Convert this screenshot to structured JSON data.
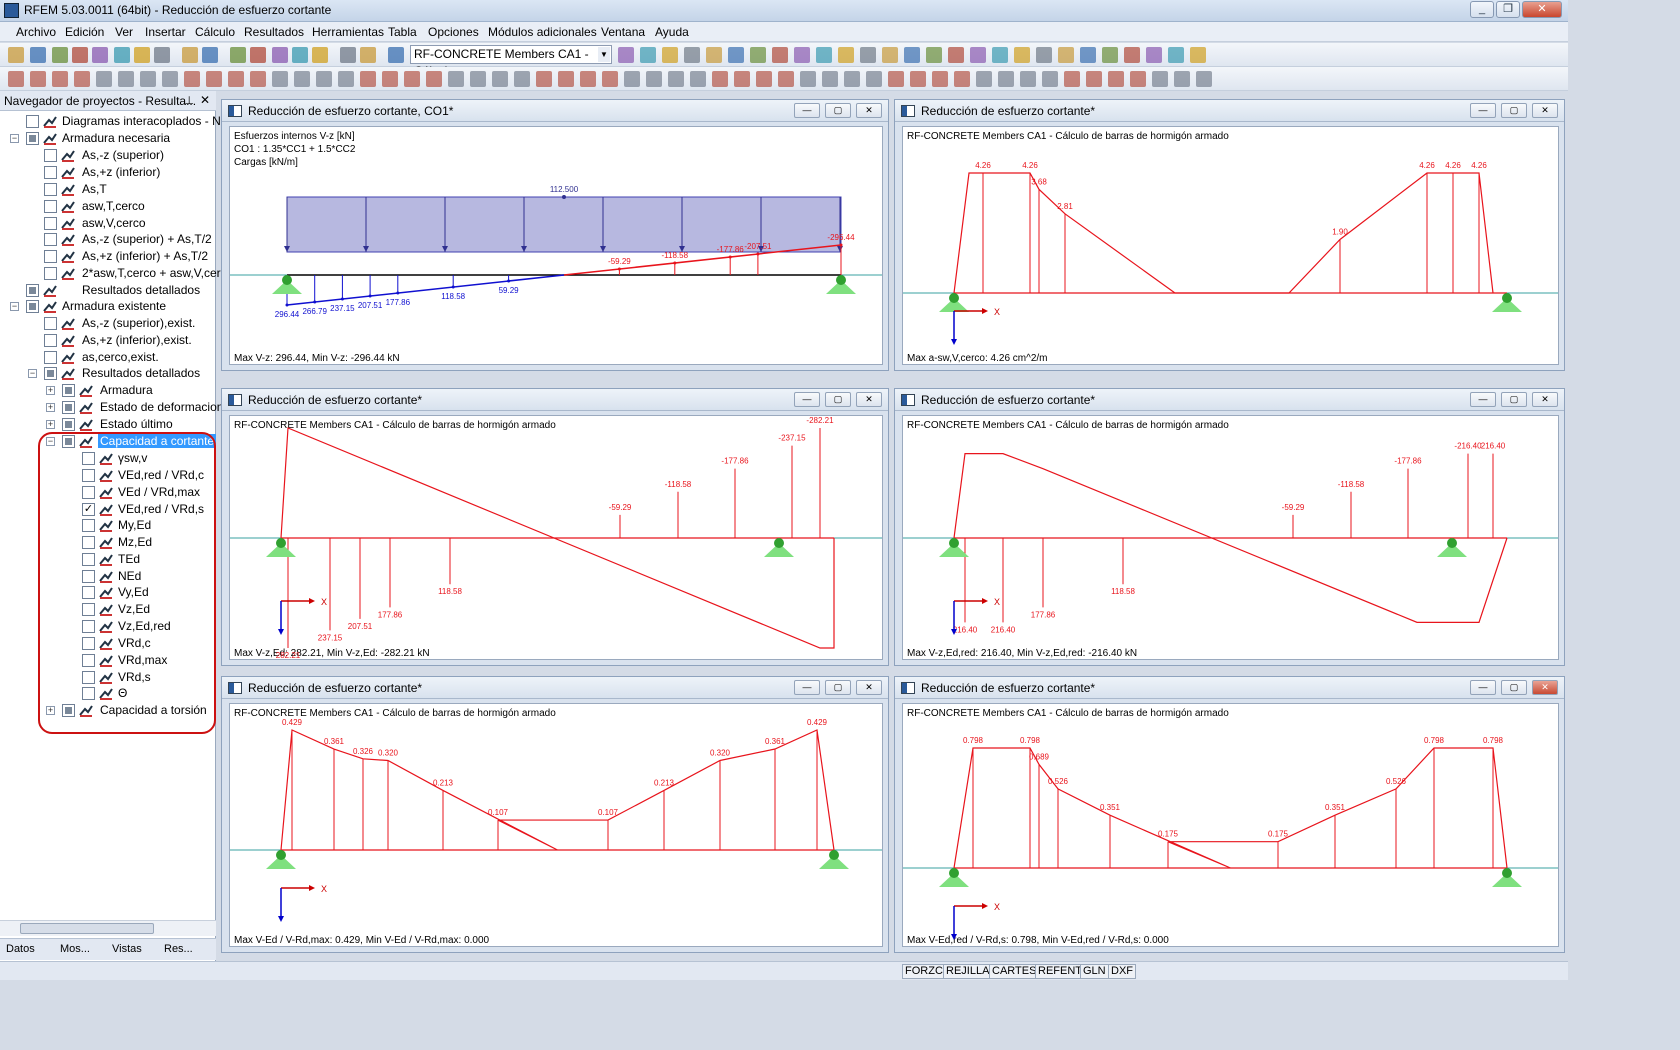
{
  "window": {
    "title": "RFEM 5.03.0011 (64bit) - Reducción de esfuerzo cortante"
  },
  "menu": [
    "Archivo",
    "Edición",
    "Ver",
    "Insertar",
    "Cálculo",
    "Resultados",
    "Herramientas",
    "Tabla",
    "Opciones",
    "Módulos adicionales",
    "Ventana",
    "Ayuda"
  ],
  "toolbar": {
    "module_combo": "RF-CONCRETE Members CA1 - Cálculo"
  },
  "navigator": {
    "title": "Navegador de proyectos - Resulta...",
    "tabs": [
      "Datos",
      "Mos...",
      "Vistas",
      "Res..."
    ],
    "items": [
      {
        "label": "Diagramas interacoplados - Nc"
      },
      {
        "label": "Armadura necesaria"
      },
      {
        "label": "As,-z (superior)"
      },
      {
        "label": "As,+z (inferior)"
      },
      {
        "label": "As,T"
      },
      {
        "label": "asw,T,cerco"
      },
      {
        "label": "asw,V,cerco"
      },
      {
        "label": "As,-z (superior) + As,T/2"
      },
      {
        "label": "As,+z (inferior) + As,T/2"
      },
      {
        "label": "2*asw,T,cerco + asw,V,cerco"
      },
      {
        "label": "Resultados detallados"
      },
      {
        "label": "Armadura existente"
      },
      {
        "label": "As,-z (superior),exist."
      },
      {
        "label": "As,+z (inferior),exist."
      },
      {
        "label": "as,cerco,exist."
      },
      {
        "label": "Resultados detallados"
      },
      {
        "label": "Armadura"
      },
      {
        "label": "Estado de deformacion"
      },
      {
        "label": "Estado último"
      },
      {
        "label": "Capacidad a cortante"
      },
      {
        "label": "γsw,v"
      },
      {
        "label": "VEd,red / VRd,c"
      },
      {
        "label": "VEd / VRd,max"
      },
      {
        "label": "VEd,red / VRd,s"
      },
      {
        "label": "My,Ed"
      },
      {
        "label": "Mz,Ed"
      },
      {
        "label": "TEd"
      },
      {
        "label": "NEd"
      },
      {
        "label": "Vy,Ed"
      },
      {
        "label": "Vz,Ed"
      },
      {
        "label": "Vz,Ed,red"
      },
      {
        "label": "VRd,c"
      },
      {
        "label": "VRd,max"
      },
      {
        "label": "VRd,s"
      },
      {
        "label": "Θ"
      },
      {
        "label": "Capacidad a torsión"
      }
    ]
  },
  "panes": [
    {
      "title": "Reducción de esfuerzo cortante, CO1*",
      "lines": [
        "Esfuerzos internos V-z [kN]",
        "CO1 : 1.35*CC1 + 1.5*CC2",
        "Cargas [kN/m]"
      ],
      "footer": "Max V-z: 296.44, Min V-z: -296.44 kN"
    },
    {
      "title": "Reducción de esfuerzo cortante*",
      "lines": [
        "RF-CONCRETE Members CA1 - Cálculo de barras de hormigón armado"
      ],
      "footer": "Max a-sw,V,cerco: 4.26 cm^2/m"
    },
    {
      "title": "Reducción de esfuerzo cortante*",
      "lines": [
        "RF-CONCRETE Members CA1 - Cálculo de barras de hormigón armado"
      ],
      "footer": "Max V-z,Ed: 282.21, Min V-z,Ed: -282.21 kN"
    },
    {
      "title": "Reducción de esfuerzo cortante*",
      "lines": [
        "RF-CONCRETE Members CA1 - Cálculo de barras de hormigón armado"
      ],
      "footer": "Max V-z,Ed,red: 216.40, Min V-z,Ed,red: -216.40 kN"
    },
    {
      "title": "Reducción de esfuerzo cortante*",
      "lines": [
        "RF-CONCRETE Members CA1 - Cálculo de barras de hormigón armado"
      ],
      "footer": "Max V-Ed / V-Rd,max: 0.429, Min V-Ed / V-Rd,max: 0.000"
    },
    {
      "title": "Reducción de esfuerzo cortante*",
      "lines": [
        "RF-CONCRETE Members CA1 - Cálculo de barras de hormigón armado"
      ],
      "footer": "Max V-Ed,red / V-Rd,s: 0.798, Min V-Ed,red / V-Rd,s: 0.000"
    }
  ],
  "statusbar": [
    "FORZC",
    "REJILLA",
    "CARTES",
    "REFENT",
    "GLN",
    "DXF"
  ],
  "chart_data": [
    {
      "type": "line",
      "title": "Esfuerzos internos V-z [kN]",
      "ylabel": "V-z [kN]",
      "load_label": "112.500",
      "series": [
        {
          "values": [
            -296.44,
            -266.79,
            -237.15,
            -207.51,
            -177.86,
            -118.58,
            -59.29,
            59.29,
            118.58,
            177.86,
            207.51,
            296.44
          ]
        }
      ],
      "labels": [
        "296.44",
        "266.79",
        "237.15",
        "207.51",
        "177.86",
        "118.58",
        "59.29",
        "-59.29",
        "-118.58",
        "-177.86",
        "-207.51",
        "-296.44"
      ]
    },
    {
      "type": "line",
      "title": "Max a-sw,V,cerco",
      "ylabel": "cm^2/m",
      "labels": [
        "4.26",
        "4.26",
        "3.68",
        "2.81",
        "1.90",
        "4.26",
        "4.26",
        "4.26"
      ],
      "values": [
        4.26,
        4.26,
        3.68,
        2.81,
        1.9,
        4.26,
        4.26,
        4.26
      ]
    },
    {
      "type": "line",
      "title": "V-z,Ed [kN]",
      "labels": [
        "282.21",
        "237.15",
        "207.51",
        "177.86",
        "118.58",
        "-59.29",
        "-118.58",
        "-177.86",
        "-237.15",
        "-282.21"
      ],
      "values": [
        282.21,
        237.15,
        207.51,
        177.86,
        118.58,
        -59.29,
        -118.58,
        -177.86,
        -237.15,
        -282.21
      ]
    },
    {
      "type": "line",
      "title": "V-z,Ed,red [kN]",
      "labels": [
        "216.40",
        "216.40",
        "177.86",
        "118.58",
        "-59.29",
        "-118.58",
        "-177.86",
        "-216.40",
        "216.40"
      ],
      "values": [
        216.4,
        216.4,
        177.86,
        118.58,
        -59.29,
        -118.58,
        -177.86,
        -216.4,
        -216.4
      ]
    },
    {
      "type": "line",
      "title": "V-Ed / V-Rd,max",
      "labels": [
        "0.429",
        "0.361",
        "0.326",
        "0.320",
        "0.213",
        "0.107",
        "0.107",
        "0.213",
        "0.320",
        "0.361",
        "0.429"
      ],
      "values": [
        0.429,
        0.361,
        0.326,
        0.32,
        0.213,
        0.107,
        0.107,
        0.213,
        0.32,
        0.361,
        0.429
      ]
    },
    {
      "type": "line",
      "title": "V-Ed,red / V-Rd,s",
      "labels": [
        "0.798",
        "0.798",
        "0.689",
        "0.526",
        "0.351",
        "0.175",
        "0.175",
        "0.351",
        "0.526",
        "0.798",
        "0.798"
      ],
      "values": [
        0.798,
        0.798,
        0.689,
        0.526,
        0.351,
        0.175,
        0.175,
        0.351,
        0.526,
        0.798,
        0.798
      ]
    }
  ]
}
